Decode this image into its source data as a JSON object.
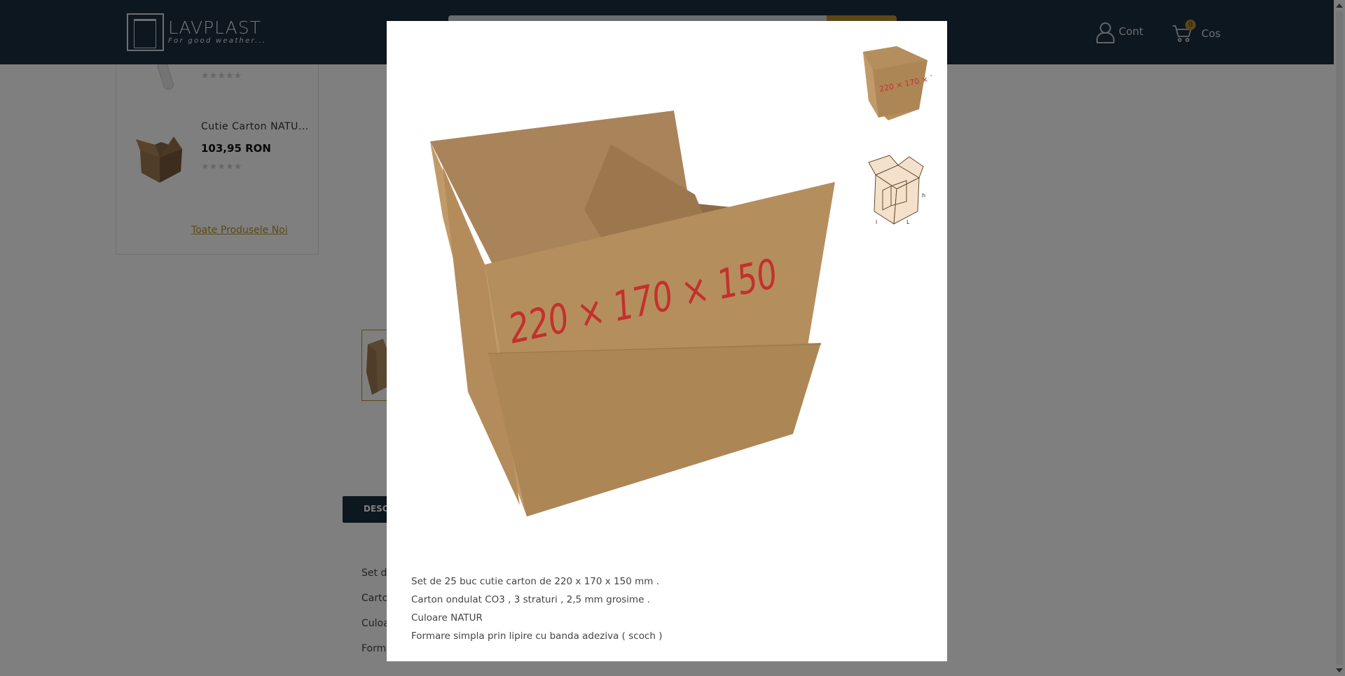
{
  "header": {
    "logo_name": "LAVPLAST",
    "logo_tagline": "For good weather...",
    "account_label": "Cont",
    "cart_label": "Cos",
    "cart_count": "0"
  },
  "sidebar": {
    "products": [
      {
        "name": "Cutie Carton NATU...",
        "price": "103,95 RON",
        "rating": 0
      }
    ],
    "all_products_link": "Toate Produsele Noi"
  },
  "page": {
    "tab_label": "DESC",
    "bg_desc_lines": [
      "Set de",
      "Carto",
      "Culoa",
      "Forma"
    ]
  },
  "modal": {
    "image_alt": "220 x 170 x 150 cardboard box",
    "box_marking": "220 × 170 × 150",
    "description_lines": [
      "Set de 25 buc cutie carton de 220 x 170 x 150 mm .",
      "Carton ondulat CO3 , 3 straturi , 2,5 mm grosime .",
      "Culoare NATUR",
      "Formare simpla prin lipire cu banda adeziva ( scoch )"
    ],
    "thumbnails": [
      "box-photo-thumb",
      "box-diagram-thumb"
    ],
    "diagram_labels": [
      "h",
      "l",
      "L"
    ]
  },
  "colors": {
    "header_bg": "#1b2f40",
    "accent": "#b8902a",
    "box": "#b58e5e",
    "marker": "#c4302c"
  }
}
